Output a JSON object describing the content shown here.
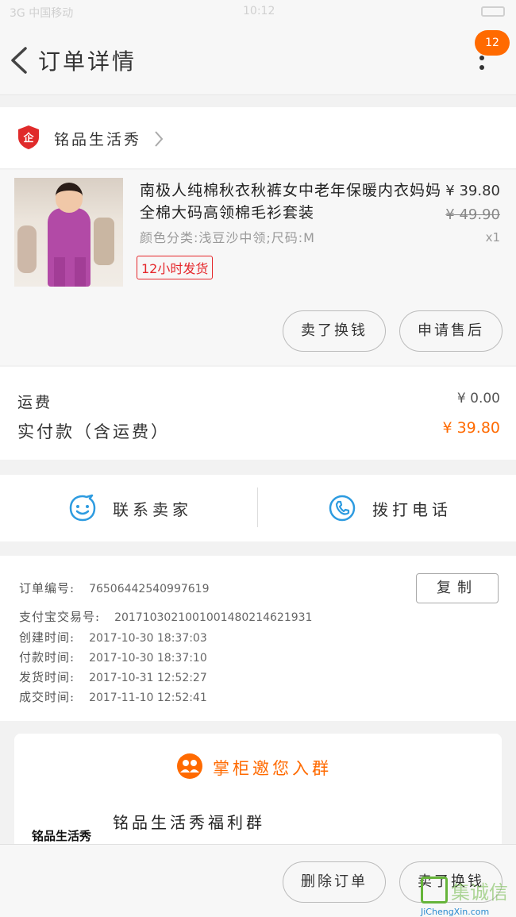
{
  "status_bar": {
    "carrier": "3G 中国移动",
    "time": "10:12"
  },
  "header": {
    "title": "订单详情",
    "badge_count": "12"
  },
  "shop": {
    "name": "铭品生活秀"
  },
  "product": {
    "name": "南极人纯棉秋衣秋裤女中老年保暖内衣妈妈全棉大码高领棉毛衫套装",
    "spec": "颜色分类:浅豆沙中领;尺码:M",
    "tag": "12小时发货",
    "price": "¥ 39.80",
    "original_price": "¥ 49.90",
    "quantity": "x1"
  },
  "product_actions": {
    "sell_label": "卖了换钱",
    "aftersale_label": "申请售后"
  },
  "fees": {
    "shipping_label": "运费",
    "shipping_value": "¥ 0.00",
    "paid_label": "实付款（含运费）",
    "paid_value": "¥ 39.80"
  },
  "contact": {
    "seller_label": "联系卖家",
    "call_label": "拨打电话"
  },
  "order_info": {
    "order_no_label": "订单编号:",
    "order_no": "76506442540997619",
    "copy_label": "复制",
    "alipay_label": "支付宝交易号:",
    "alipay_no": "2017103021001001480214621931",
    "created_label": "创建时间:",
    "created": "2017-10-30 18:37:03",
    "paid_label": "付款时间:",
    "paid": "2017-10-30 18:37:10",
    "shipped_label": "发货时间:",
    "shipped": "2017-10-31 12:52:27",
    "done_label": "成交时间:",
    "done": "2017-11-10 12:52:41"
  },
  "group": {
    "title": "掌柜邀您入群",
    "logo_text": "铭品生活秀",
    "name": "铭品生活秀福利群"
  },
  "bottom_bar": {
    "delete_label": "删除订单",
    "sell_label": "卖了换钱"
  },
  "watermark": {
    "text": "集诚信",
    "url": "JiChengXin.com"
  },
  "colors": {
    "accent": "#ff6a00",
    "tag_red": "#e5262a",
    "icon_blue": "#2d9be0"
  }
}
